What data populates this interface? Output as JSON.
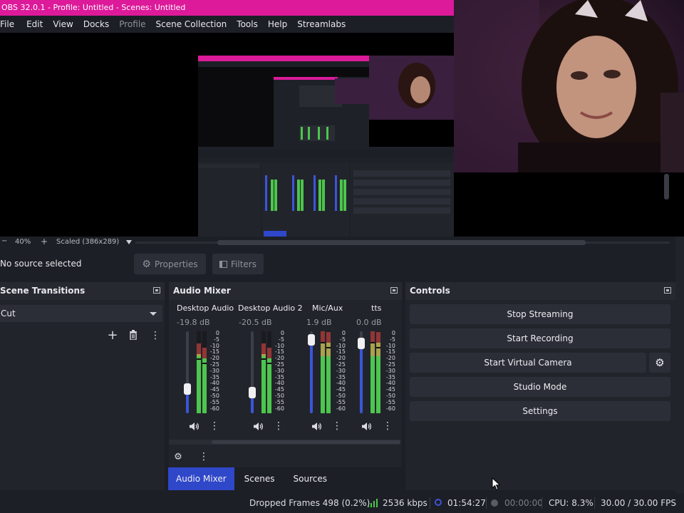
{
  "window": {
    "title": "OBS 32.0.1 - Profile: Untitled - Scenes: Untitled"
  },
  "menu": [
    "File",
    "Edit",
    "View",
    "Docks",
    "Profile",
    "Scene Collection",
    "Tools",
    "Help",
    "Streamlabs"
  ],
  "preview": {
    "zoom": "40%",
    "scale_mode": "Scaled (386x289)",
    "nested_labels": [
      "Stop Streaming",
      "Start Recording",
      "Start Virtual Camera",
      "Studio Mode",
      "Settings",
      "Audio Mixer",
      "Controls",
      "Scene Transitions",
      "No source selected"
    ]
  },
  "source_bar": {
    "status": "No source selected",
    "properties_label": "Properties",
    "filters_label": "Filters"
  },
  "scene_transitions": {
    "title": "Scene Transitions",
    "selected": "Cut"
  },
  "audio_mixer": {
    "title": "Audio Mixer",
    "channels": [
      {
        "name": "Desktop Audio",
        "db": "-19.8 dB",
        "level": 0.3
      },
      {
        "name": "Desktop Audio 2",
        "db": "-20.5 dB",
        "level": 0.25
      },
      {
        "name": "Mic/Aux",
        "db": "1.9 dB",
        "level": 0.9
      },
      {
        "name": "tts",
        "db": "0.0 dB",
        "level": 0.85
      }
    ],
    "scale": [
      "0",
      "-5",
      "-10",
      "-15",
      "-20",
      "-25",
      "-30",
      "-35",
      "-40",
      "-45",
      "-50",
      "-55",
      "-60"
    ]
  },
  "controls": {
    "title": "Controls",
    "buttons": [
      "Stop Streaming",
      "Start Recording",
      "Start Virtual Camera",
      "Studio Mode",
      "Settings"
    ]
  },
  "tabs": [
    "Audio Mixer",
    "Scenes",
    "Sources"
  ],
  "status": {
    "dropped_frames": "Dropped Frames 498 (0.2%)",
    "bitrate": "2536 kbps",
    "stream_time": "01:54:27",
    "record_time": "00:00:00",
    "cpu": "CPU: 8.3%",
    "fps": "30.00 / 30.00 FPS"
  },
  "colors": {
    "accent": "#2f47c9",
    "title_bar": "#dc1a9a",
    "meter_green": "#4cc64c",
    "fader_blue": "#3b55d9"
  }
}
